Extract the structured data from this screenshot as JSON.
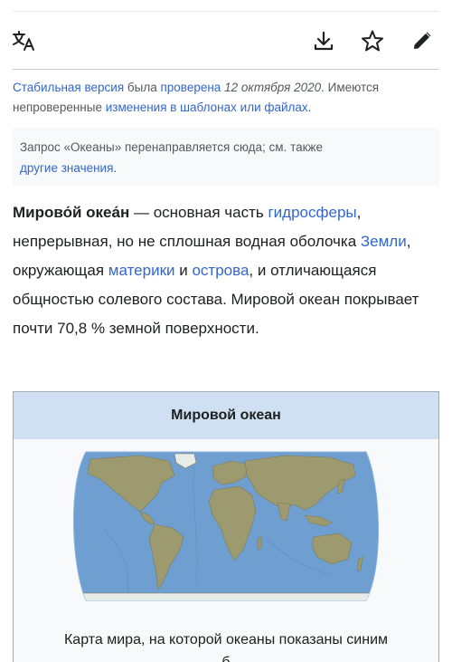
{
  "colors": {
    "link": "#3366cc",
    "text": "#202122",
    "muted": "#54595d",
    "infobox_header": "#cee0f2",
    "ocean": "#6f9fd0",
    "land": "#9c9a6e"
  },
  "toolbar": {
    "language_icon": "translate-icon",
    "download_icon": "download-icon",
    "star_icon": "star-icon",
    "edit_icon": "pencil-icon"
  },
  "stable_notice": {
    "link_stable": "Стабильная версия",
    "text_1": " была ",
    "link_checked": "проверена",
    "date": " 12 октября 2020",
    "text_2": ". Имеются непроверенные ",
    "link_changes": "изменения в шаблонах или файлах",
    "text_3": "."
  },
  "hatnote": {
    "text": "Запрос «Океаны» перенаправляется сюда; см. также",
    "link": "другие значения",
    "end": "."
  },
  "lead": {
    "term": "Мирово́й океа́н",
    "t1": " — основная часть ",
    "link_hydro": "гидросферы",
    "t2": ", непрерывная, но не сплошная водная оболочка ",
    "link_earth": "Земли",
    "t3": ", окружающая ",
    "link_continents": "материки",
    "t4": " и ",
    "link_islands": "острова",
    "t5": ", и отличающаяся общностью солевого состава. Мировой океан покрывает почти 70,8 % земной поверхности."
  },
  "infobox": {
    "title": "Мировой океан",
    "caption": "Карта мира, на которой океаны показаны синим",
    "caption_cut": "б"
  }
}
